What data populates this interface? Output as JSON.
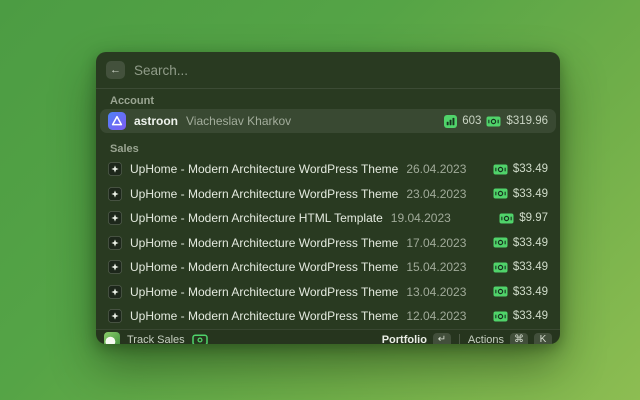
{
  "search": {
    "placeholder": "Search...",
    "back_icon": "←"
  },
  "account": {
    "section_label": "Account",
    "name": "astroon",
    "subtitle": "Viacheslav Kharkov",
    "sales_count": "603",
    "total_amount": "$319.96"
  },
  "sales": {
    "section_label": "Sales",
    "rows": [
      {
        "title": "UpHome - Modern Architecture WordPress Theme",
        "date": "26.04.2023",
        "amount": "$33.49"
      },
      {
        "title": "UpHome - Modern Architecture WordPress Theme",
        "date": "23.04.2023",
        "amount": "$33.49"
      },
      {
        "title": "UpHome - Modern Architecture HTML Template",
        "date": "19.04.2023",
        "amount": "$9.97"
      },
      {
        "title": "UpHome - Modern Architecture WordPress Theme",
        "date": "17.04.2023",
        "amount": "$33.49"
      },
      {
        "title": "UpHome - Modern Architecture WordPress Theme",
        "date": "15.04.2023",
        "amount": "$33.49"
      },
      {
        "title": "UpHome - Modern Architecture WordPress Theme",
        "date": "13.04.2023",
        "amount": "$33.49"
      },
      {
        "title": "UpHome - Modern Architecture WordPress Theme",
        "date": "12.04.2023",
        "amount": "$33.49"
      }
    ]
  },
  "footer": {
    "app_name": "Track Sales",
    "primary_action": "Portfolio",
    "primary_key": "↵",
    "secondary_action": "Actions",
    "secondary_keys": [
      "⌘",
      "K"
    ]
  },
  "colors": {
    "accent_green": "#50d36a",
    "window_bg": "#293a21",
    "background_gradient_from": "#4c9c43",
    "background_gradient_to": "#8dbd52",
    "astroon_brand_from": "#4f82f7",
    "astroon_brand_to": "#7e5bf2"
  }
}
